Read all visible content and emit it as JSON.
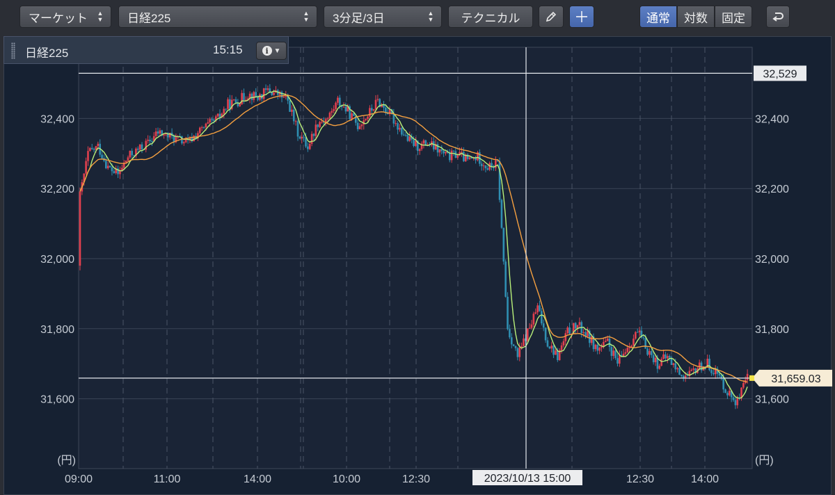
{
  "toolbar": {
    "market_select": "マーケット",
    "symbol_select": "日経225",
    "interval_select": "3分足/3日",
    "technical_button": "テクニカル",
    "scale_tabs": [
      {
        "label": "通常",
        "active": true
      },
      {
        "label": "対数",
        "active": false
      },
      {
        "label": "固定",
        "active": false
      }
    ]
  },
  "panel": {
    "symbol": "日経225",
    "time": "15:15"
  },
  "chart_data": {
    "type": "candlestick",
    "title": "",
    "unit_label": "(円)",
    "ylim": [
      31500,
      32570
    ],
    "yticks": [
      {
        "value": 32400,
        "label": "32,400"
      },
      {
        "value": 32200,
        "label": "32,200"
      },
      {
        "value": 32000,
        "label": "32,000"
      },
      {
        "value": 31800,
        "label": "31,800"
      },
      {
        "value": 31600,
        "label": "31,600"
      }
    ],
    "xticks": [
      "09:00",
      "11:00",
      "14:00",
      "10:00",
      "12:30",
      "1",
      "00",
      "12:30",
      "14:00"
    ],
    "high_marker": {
      "value": 32529,
      "label": "32,529"
    },
    "last_price": {
      "value": 31659.03,
      "label": "31,659.03"
    },
    "crosshair_label": "2023/10/13 15:00",
    "grid": true,
    "series": [
      {
        "kind": "close",
        "values": [
          32150,
          32300,
          32320,
          32260,
          32240,
          32290,
          32310,
          32330,
          32360,
          32350,
          32340,
          32330,
          32360,
          32380,
          32400,
          32440,
          32450,
          32470,
          32460,
          32480,
          32470,
          32450,
          32360,
          32320,
          32390,
          32400,
          32450,
          32420,
          32380,
          32410,
          32450,
          32420,
          32380,
          32340,
          32320,
          32330,
          32310,
          32290,
          32300,
          32280,
          32290,
          32260,
          32270,
          31800,
          31720,
          31790,
          31860,
          31760,
          31720,
          31790,
          31810,
          31780,
          31740,
          31760,
          31700,
          31750,
          31790,
          31740,
          31700,
          31720,
          31680,
          31660,
          31690,
          31700,
          31670,
          31620,
          31590,
          31659
        ]
      },
      {
        "kind": "ma_fast_color",
        "values": [
          "#b8f07a"
        ]
      },
      {
        "kind": "ma_slow_color",
        "values": [
          "#f5a040"
        ]
      }
    ],
    "colors": {
      "up": "#e2404e",
      "down": "#2f8fb2",
      "ma_fast": "#b8f07a",
      "ma_slow": "#f5a040"
    }
  }
}
